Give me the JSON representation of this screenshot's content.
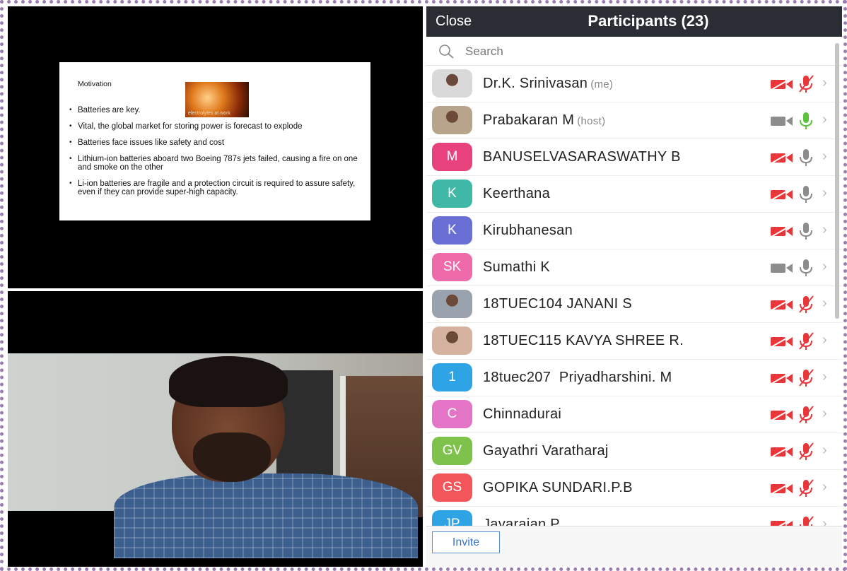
{
  "slide": {
    "title": "Motivation",
    "image_caption": "electrolytes at work",
    "bullets": [
      "Batteries are key.",
      "Vital, the global market for storing power is forecast to explode",
      "Batteries face issues like safety and cost",
      "Lithium-ion batteries aboard two Boeing 787s jets failed, causing a fire on one and smoke on the other",
      "Li-ion batteries are fragile and a protection circuit is required to assure safety, even if they can provide super-high capacity."
    ]
  },
  "panel": {
    "close_label": "Close",
    "title": "Participants (23)",
    "search_placeholder": "Search",
    "invite_label": "Invite"
  },
  "participants": [
    {
      "name": "Dr.K. Srinivasan",
      "tag": "(me)",
      "avatar": "photo",
      "color": "#d9d9d9",
      "cam": "off",
      "mic": "muted"
    },
    {
      "name": "Prabakaran M",
      "tag": "(host)",
      "avatar": "photo",
      "color": "#b8a48a",
      "cam": "on",
      "mic": "active"
    },
    {
      "name": "BANUSELVASARASWATHY B",
      "tag": "",
      "avatar": "M",
      "color": "#e8427c",
      "cam": "off",
      "mic": "on"
    },
    {
      "name": "Keerthana",
      "tag": "",
      "avatar": "K",
      "color": "#3fb8a8",
      "cam": "off",
      "mic": "on"
    },
    {
      "name": "Kirubhanesan",
      "tag": "",
      "avatar": "K",
      "color": "#6a6fd6",
      "cam": "off",
      "mic": "on"
    },
    {
      "name": "Sumathi K",
      "tag": "",
      "avatar": "SK",
      "color": "#ee6aa8",
      "cam": "on",
      "mic": "on"
    },
    {
      "name": "18TUEC104 JANANI S",
      "tag": "",
      "avatar": "photo",
      "color": "#9aa3ad",
      "cam": "off",
      "mic": "muted"
    },
    {
      "name": "18TUEC115 KAVYA SHREE R.",
      "tag": "",
      "avatar": "photo",
      "color": "#d6b3a0",
      "cam": "off",
      "mic": "muted"
    },
    {
      "name": "18tuec207  Priyadharshini. M",
      "tag": "",
      "avatar": "1",
      "color": "#2ea4e6",
      "cam": "off",
      "mic": "muted"
    },
    {
      "name": "Chinnadurai",
      "tag": "",
      "avatar": "C",
      "color": "#e474c6",
      "cam": "off",
      "mic": "muted"
    },
    {
      "name": "Gayathri Varatharaj",
      "tag": "",
      "avatar": "GV",
      "color": "#7fc24b",
      "cam": "off",
      "mic": "muted"
    },
    {
      "name": "GOPIKA SUNDARI.P.B",
      "tag": "",
      "avatar": "GS",
      "color": "#f2555a",
      "cam": "off",
      "mic": "muted"
    },
    {
      "name": "Jayarajan P",
      "tag": "",
      "avatar": "JP",
      "color": "#2ea4e6",
      "cam": "off",
      "mic": "muted"
    }
  ],
  "colors": {
    "header_bg": "#2a2d34",
    "muted_red": "#e8373a",
    "active_green": "#5cc23c",
    "icon_gray": "#8c8c8c",
    "invite_blue": "#3b74c0"
  }
}
